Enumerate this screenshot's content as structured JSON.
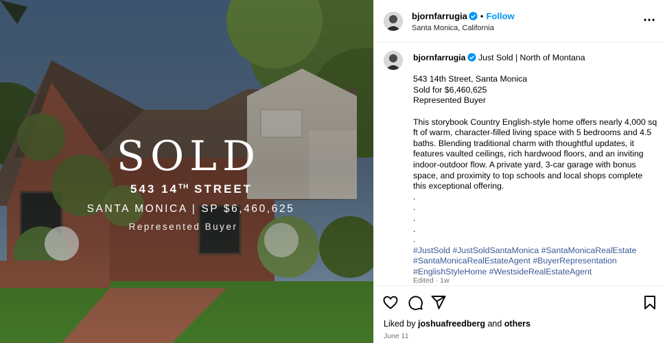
{
  "header": {
    "username": "bjornfarrugia",
    "separator": "•",
    "follow_label": "Follow",
    "location": "Santa Monica, California",
    "more_icon": "more-horizontal-icon"
  },
  "image": {
    "sold_text": "SOLD",
    "street_prefix": "543 14",
    "street_sup": "TH",
    "street_suffix": " STREET",
    "city_line": "SANTA MONICA | SP $6,460,625",
    "represented": "Represented Buyer"
  },
  "caption": {
    "username": "bjornfarrugia",
    "headline": "Just Sold | North of Montana",
    "address": "543 14th Street, Santa Monica",
    "sold_for": "Sold for $6,460,625",
    "represented": "Represented Buyer",
    "description": "This storybook Country English-style home offers nearly 4,000 sq ft of warm, character-filled living space with 5 bedrooms and 4.5 baths. Blending traditional charm with thoughtful updates, it features vaulted ceilings, rich hardwood floors, and an inviting indoor-outdoor flow. A private yard, 3-car garage with bonus space, and proximity to top schools and local shops complete this exceptional offering.",
    "dots": [
      ".",
      ".",
      ".",
      ".",
      "."
    ],
    "hashtags": [
      "#JustSold",
      "#JustSoldSantaMonica",
      "#SantaMonicaRealEstate",
      "#SantaMonicaRealEstateAgent",
      "#BuyerRepresentation",
      "#EnglishStyleHome",
      "#WestsideRealEstateAgent"
    ],
    "edited": "Edited · 1w"
  },
  "actions": {
    "liked_by_prefix": "Liked by ",
    "liked_by_user": "joshuafreedberg",
    "liked_by_and": " and ",
    "liked_by_others": "others",
    "date": "June 11"
  },
  "colors": {
    "follow": "#0095f6",
    "hashtag": "#385898",
    "muted": "#737373"
  }
}
